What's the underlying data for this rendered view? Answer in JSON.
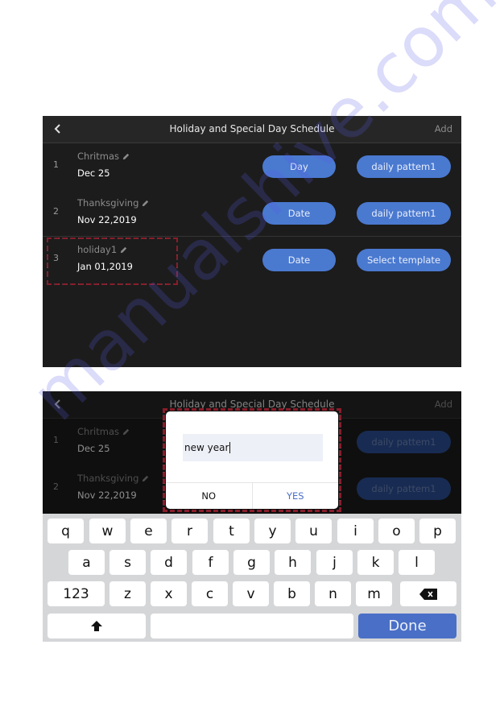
{
  "header": {
    "title": "Holiday and Special Day Schedule",
    "add_label": "Add"
  },
  "screen1": {
    "rows": [
      {
        "index": "1",
        "name": "Chritmas",
        "date": "Dec 25",
        "type": "Day",
        "template": "daily pattem1"
      },
      {
        "index": "2",
        "name": "Thanksgiving",
        "date": "Nov 22,2019",
        "type": "Date",
        "template": "daily pattem1"
      },
      {
        "index": "3",
        "name": "holiday1",
        "date": "Jan 01,2019",
        "type": "Date",
        "template": "Select template"
      }
    ]
  },
  "screen2": {
    "rows": [
      {
        "index": "1",
        "name": "Chritmas",
        "date": "Dec 25",
        "template": "daily pattem1"
      },
      {
        "index": "2",
        "name": "Thanksgiving",
        "date": "Nov 22,2019",
        "template": "daily pattem1"
      }
    ],
    "dialog": {
      "input_value": "new year",
      "no_label": "NO",
      "yes_label": "YES"
    },
    "keyboard": {
      "row1": [
        "q",
        "w",
        "e",
        "r",
        "t",
        "y",
        "u",
        "i",
        "o",
        "p"
      ],
      "row2": [
        "a",
        "s",
        "d",
        "f",
        "g",
        "h",
        "j",
        "k",
        "l"
      ],
      "row3": [
        "z",
        "x",
        "c",
        "v",
        "b",
        "n",
        "m"
      ],
      "numbers_label": "123",
      "done_label": "Done",
      "icons": {
        "shift": "shift-up-arrow",
        "backspace": "backspace-x"
      }
    }
  },
  "icons": {
    "back": "chevron-left",
    "edit": "pencil"
  },
  "colors": {
    "accent": "#4a79d0",
    "background": "#1c1c1c",
    "header": "#262626",
    "highlight": "#8a1c2a"
  },
  "watermark": "manualshive.com"
}
